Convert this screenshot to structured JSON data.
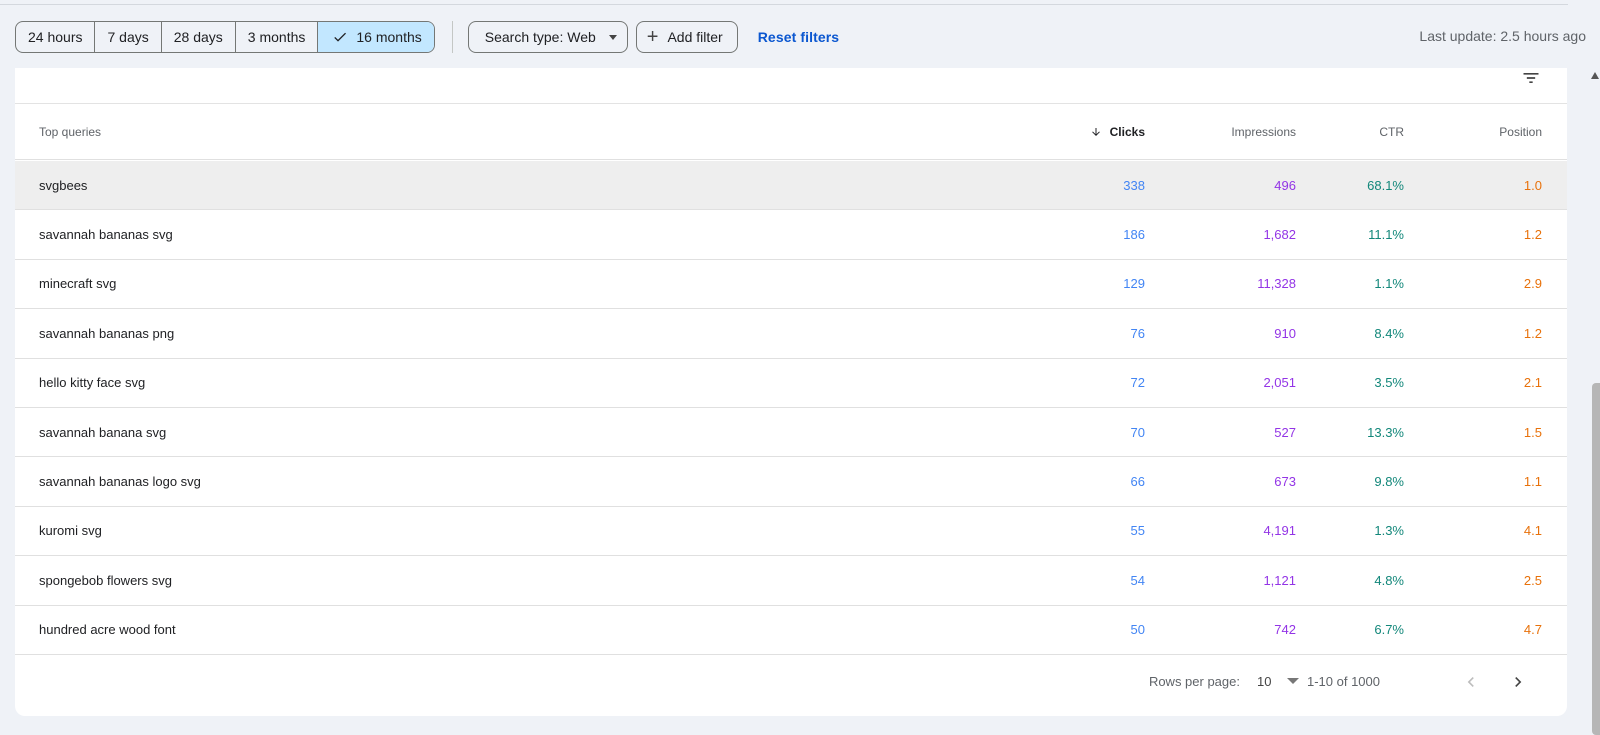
{
  "filters": {
    "time_ranges": [
      "24 hours",
      "7 days",
      "28 days",
      "3 months",
      "16 months"
    ],
    "selected_range": "16 months",
    "search_type": "Search type: Web",
    "add_filter": "Add filter",
    "reset": "Reset filters"
  },
  "last_update": "Last update: 2.5 hours ago",
  "table": {
    "headers": {
      "query": "Top queries",
      "clicks": "Clicks",
      "impressions": "Impressions",
      "ctr": "CTR",
      "position": "Position"
    },
    "rows": [
      {
        "query": "svgbees",
        "clicks": "338",
        "impressions": "496",
        "ctr": "68.1%",
        "position": "1.0"
      },
      {
        "query": "savannah bananas svg",
        "clicks": "186",
        "impressions": "1,682",
        "ctr": "11.1%",
        "position": "1.2"
      },
      {
        "query": "minecraft svg",
        "clicks": "129",
        "impressions": "11,328",
        "ctr": "1.1%",
        "position": "2.9"
      },
      {
        "query": "savannah bananas png",
        "clicks": "76",
        "impressions": "910",
        "ctr": "8.4%",
        "position": "1.2"
      },
      {
        "query": "hello kitty face svg",
        "clicks": "72",
        "impressions": "2,051",
        "ctr": "3.5%",
        "position": "2.1"
      },
      {
        "query": "savannah banana svg",
        "clicks": "70",
        "impressions": "527",
        "ctr": "13.3%",
        "position": "1.5"
      },
      {
        "query": "savannah bananas logo svg",
        "clicks": "66",
        "impressions": "673",
        "ctr": "9.8%",
        "position": "1.1"
      },
      {
        "query": "kuromi svg",
        "clicks": "55",
        "impressions": "4,191",
        "ctr": "1.3%",
        "position": "4.1"
      },
      {
        "query": "spongebob flowers svg",
        "clicks": "54",
        "impressions": "1,121",
        "ctr": "4.8%",
        "position": "2.5"
      },
      {
        "query": "hundred acre wood font",
        "clicks": "50",
        "impressions": "742",
        "ctr": "6.7%",
        "position": "4.7"
      }
    ]
  },
  "pagination": {
    "rows_per_page_label": "Rows per page:",
    "rows_per_page": "10",
    "range": "1-10 of 1000"
  },
  "colors": {
    "clicks": "#4285f4",
    "impressions": "#9334e6",
    "ctr": "#12877a",
    "position": "#e8710a",
    "selected_chip": "#c2e7ff",
    "link": "#0b57d0"
  },
  "icons": [
    "check-icon",
    "dropdown-caret-icon",
    "plus-icon",
    "filter-list-icon",
    "sort-down-arrow-icon",
    "chevron-left-icon",
    "chevron-right-icon"
  ]
}
